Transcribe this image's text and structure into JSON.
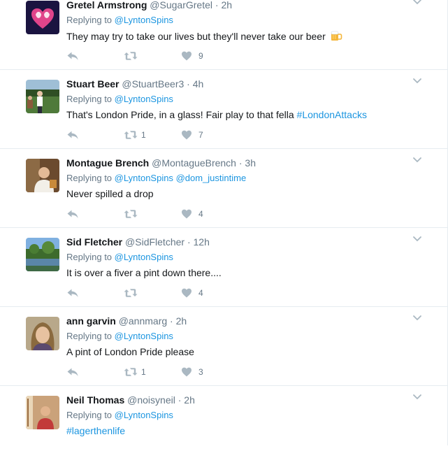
{
  "colors": {
    "link": "#1b95e0",
    "muted": "#657786",
    "text": "#14171a",
    "border": "#e6ecf0",
    "icon": "#aab8c2"
  },
  "icons": {
    "reply": "reply-icon",
    "retweet": "retweet-icon",
    "like": "heart-icon",
    "more": "chevron-down-icon",
    "beer": "beer-mug-emoji"
  },
  "tweets": [
    {
      "fullname": "Gretel Armstrong",
      "username": "@SugarGretel",
      "sep": "·",
      "time": "2h",
      "replying_prefix": "Replying to",
      "replying_to": "@LyntonSpins",
      "replying_to_extra": "",
      "text": "They may try to take our lives but they'll never take our beer",
      "hashtag": "",
      "retweets": "",
      "likes": "9"
    },
    {
      "fullname": "Stuart Beer",
      "username": "@StuartBeer3",
      "sep": "·",
      "time": "4h",
      "replying_prefix": "Replying to",
      "replying_to": "@LyntonSpins",
      "replying_to_extra": "",
      "text": "That's London Pride, in a glass! Fair play to that fella ",
      "hashtag": "#LondonAttacks",
      "retweets": "1",
      "likes": "7"
    },
    {
      "fullname": "Montague Brench",
      "username": "@MontagueBrench",
      "sep": "·",
      "time": "3h",
      "replying_prefix": "Replying to",
      "replying_to": "@LyntonSpins",
      "replying_to_extra": "@dom_justintime",
      "text": "Never spilled a drop",
      "hashtag": "",
      "retweets": "",
      "likes": "4"
    },
    {
      "fullname": "Sid Fletcher",
      "username": "@SidFletcher",
      "sep": "·",
      "time": "12h",
      "replying_prefix": "Replying to",
      "replying_to": "@LyntonSpins",
      "replying_to_extra": "",
      "text": "It is over a fiver a pint down there....",
      "hashtag": "",
      "retweets": "",
      "likes": "4"
    },
    {
      "fullname": "ann garvin",
      "username": "@annmarg",
      "sep": "·",
      "time": "2h",
      "replying_prefix": "Replying to",
      "replying_to": "@LyntonSpins",
      "replying_to_extra": "",
      "text": "A pint of London Pride please",
      "hashtag": "",
      "retweets": "1",
      "likes": "3"
    },
    {
      "fullname": "Neil Thomas",
      "username": "@noisyneil",
      "sep": "·",
      "time": "2h",
      "replying_prefix": "Replying to",
      "replying_to": "@LyntonSpins",
      "replying_to_extra": "",
      "text": "",
      "hashtag": "#lagerthenlife",
      "retweets": "",
      "likes": ""
    }
  ]
}
